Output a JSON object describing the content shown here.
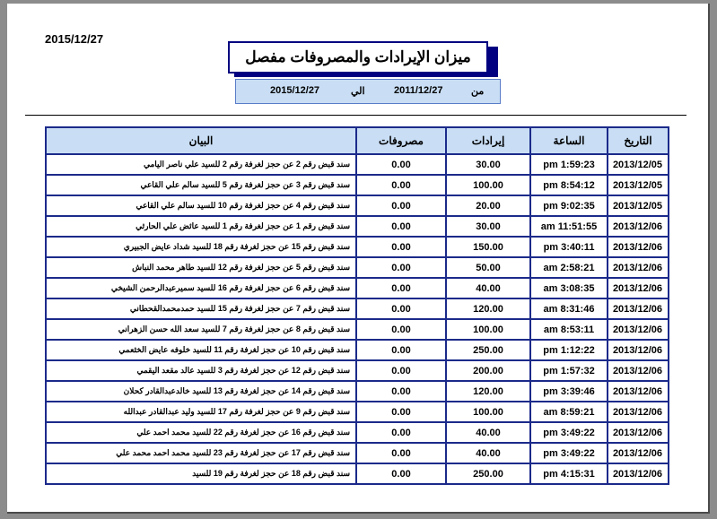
{
  "report": {
    "print_date": "2015/12/27",
    "title": "ميزان الإيرادات والمصروفات مفصل",
    "period": {
      "from_label": "من",
      "from_date": "2011/12/27",
      "to_label": "الي",
      "to_date": "2015/12/27"
    },
    "columns": {
      "date": "التاريخ",
      "time": "الساعة",
      "income": "إيرادات",
      "expenses": "مصروفات",
      "description": "البيان"
    },
    "rows": [
      {
        "date": "2013/12/05",
        "time": "1:59:23 pm",
        "income": "30.00",
        "expenses": "0.00",
        "description": "سند قبض رقم 2 عن حجز لغرفة رقم 2 للسيد علي ناصر اليامي"
      },
      {
        "date": "2013/12/05",
        "time": "8:54:12 pm",
        "income": "100.00",
        "expenses": "0.00",
        "description": "سند قبض رقم 3 عن حجز لغرفة رقم 5 للسيد سالم علي القاعي"
      },
      {
        "date": "2013/12/05",
        "time": "9:02:35 pm",
        "income": "20.00",
        "expenses": "0.00",
        "description": "سند قبض رقم 4 عن حجز لغرفة رقم 10 للسيد سالم علي القاعي"
      },
      {
        "date": "2013/12/06",
        "time": "11:51:55 am",
        "income": "30.00",
        "expenses": "0.00",
        "description": "سند قبض رقم 1 عن حجز لغرفة رقم 1 للسيد عائض علي الحارثي"
      },
      {
        "date": "2013/12/06",
        "time": "3:40:11 pm",
        "income": "150.00",
        "expenses": "0.00",
        "description": "سند قبض رقم 15 عن حجز لغرفة رقم 18 للسيد شداد عايض الجبيري"
      },
      {
        "date": "2013/12/06",
        "time": "2:58:21 am",
        "income": "50.00",
        "expenses": "0.00",
        "description": "سند قبض رقم 5 عن حجز لغرفة رقم 12 للسيد طاهر محمد النباش"
      },
      {
        "date": "2013/12/06",
        "time": "3:08:35 am",
        "income": "40.00",
        "expenses": "0.00",
        "description": "سند قبض رقم 6 عن حجز لغرفة رقم 16 للسيد سميرعبدالرحمن الشيخي"
      },
      {
        "date": "2013/12/06",
        "time": "8:31:46 am",
        "income": "120.00",
        "expenses": "0.00",
        "description": "سند قبض رقم 7 عن حجز لغرفة رقم 15 للسيد حمدمحمدالقحطاني"
      },
      {
        "date": "2013/12/06",
        "time": "8:53:11 am",
        "income": "100.00",
        "expenses": "0.00",
        "description": "سند قبض رقم 8 عن حجز لغرفة رقم 7 للسيد سعد الله حسن الزهراني"
      },
      {
        "date": "2013/12/06",
        "time": "1:12:22 pm",
        "income": "250.00",
        "expenses": "0.00",
        "description": "سند قبض رقم 10 عن حجز لغرفة رقم 11 للسيد خلوفه عايض الخثعمي"
      },
      {
        "date": "2013/12/06",
        "time": "1:57:32 pm",
        "income": "200.00",
        "expenses": "0.00",
        "description": "سند قبض رقم 12 عن حجز لغرفة رقم 3 للسيد عالد مقعد اليقمي"
      },
      {
        "date": "2013/12/06",
        "time": "3:39:46 pm",
        "income": "120.00",
        "expenses": "0.00",
        "description": "سند قبض رقم 14 عن حجز لغرفة رقم 13 للسيد خالدعبدالقادر كحلان"
      },
      {
        "date": "2013/12/06",
        "time": "8:59:21 am",
        "income": "100.00",
        "expenses": "0.00",
        "description": "سند قبض رقم 9 عن حجز لغرفة رقم 17 للسيد وليد عبدالقادر عبدالله"
      },
      {
        "date": "2013/12/06",
        "time": "3:49:22 pm",
        "income": "40.00",
        "expenses": "0.00",
        "description": "سند قبض رقم 16 عن حجز لغرفة رقم 22 للسيد محمد احمد علي"
      },
      {
        "date": "2013/12/06",
        "time": "3:49:22 pm",
        "income": "40.00",
        "expenses": "0.00",
        "description": "سند قبض رقم 17 عن حجز لغرفة رقم 23 للسيد محمد احمد محمد علي"
      },
      {
        "date": "2013/12/06",
        "time": "4:15:31 pm",
        "income": "250.00",
        "expenses": "0.00",
        "description": "سند قبض رقم 18 عن حجز لغرفة رقم 19 للسيد"
      }
    ]
  }
}
